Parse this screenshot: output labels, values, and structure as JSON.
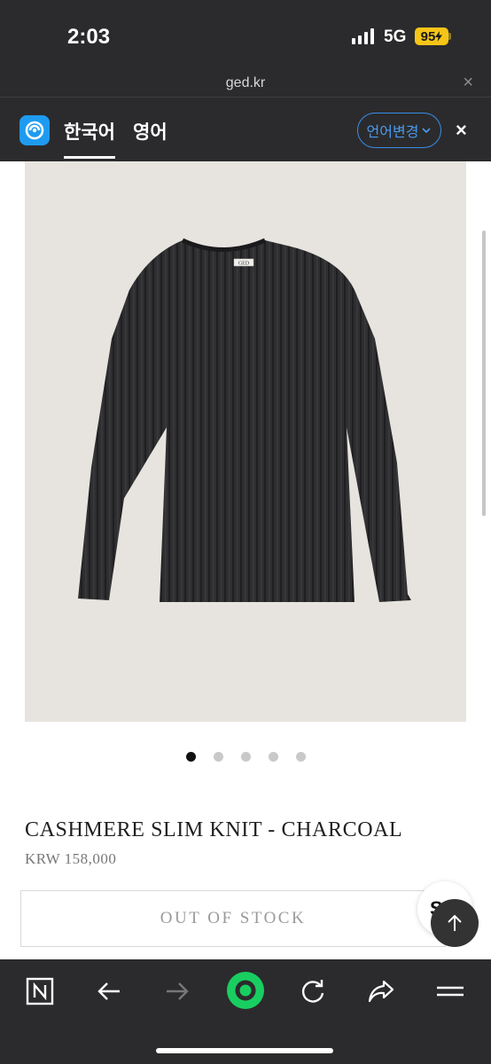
{
  "status_bar": {
    "time": "2:03",
    "network": "5G",
    "battery": "95"
  },
  "browser": {
    "url": "ged.kr",
    "close_label": "×"
  },
  "translate_bar": {
    "tabs": [
      {
        "label": "한국어",
        "active": true
      },
      {
        "label": "영어",
        "active": false
      }
    ],
    "change_language_label": "언어변경",
    "close_label": "×"
  },
  "product": {
    "image_label": "GED",
    "title": "CASHMERE SLIM KNIT - CHARCOAL",
    "price": "KRW 158,000",
    "stock_button_label": "OUT OF STOCK",
    "carousel": {
      "count": 5,
      "active_index": 0
    }
  },
  "floating": {
    "chat_partial_label": "S"
  },
  "bottom_nav": {
    "items": [
      "naver-home-icon",
      "back-arrow-icon",
      "forward-arrow-icon",
      "green-dot-icon",
      "refresh-icon",
      "share-icon",
      "menu-icon"
    ]
  },
  "colors": {
    "chrome_bg": "#2b2b2d",
    "accent_blue": "#1e9bf0",
    "battery_yellow": "#f5c518",
    "green_button": "#19ce60",
    "image_bg": "#e7e4df"
  }
}
